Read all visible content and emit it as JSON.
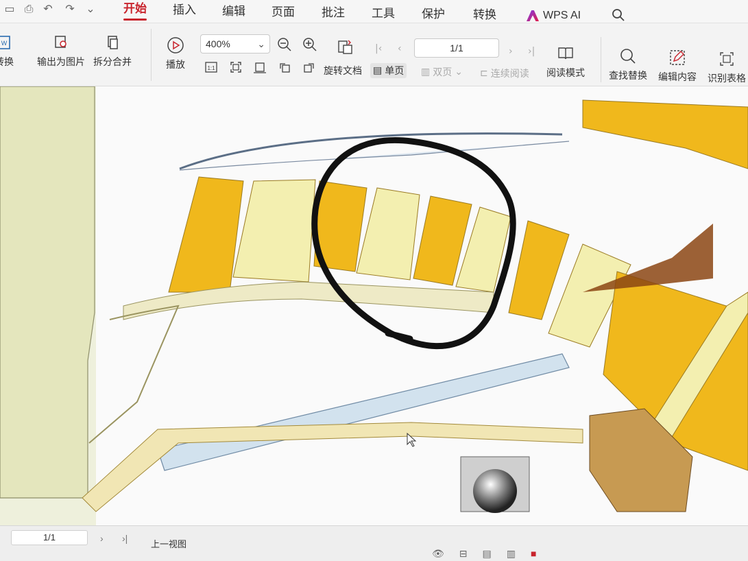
{
  "menubar": {
    "tabs": [
      {
        "label": "开始",
        "active": true
      },
      {
        "label": "插入"
      },
      {
        "label": "编辑"
      },
      {
        "label": "页面"
      },
      {
        "label": "批注"
      },
      {
        "label": "工具"
      },
      {
        "label": "保护"
      },
      {
        "label": "转换"
      }
    ],
    "ai_label": "WPS AI",
    "accent_color": "#c8232c"
  },
  "toolbar": {
    "convert_label": "转换",
    "export_image_label": "输出为图片",
    "split_merge_label": "拆分合并",
    "play_label": "播放",
    "zoom_value": "400%",
    "rotate_doc_label": "旋转文档",
    "page_value": "1/1",
    "single_page_label": "单页",
    "double_page_label": "双页",
    "continuous_label": "连续阅读",
    "reading_mode_label": "阅读模式",
    "find_replace_label": "查找替换",
    "edit_content_label": "编辑内容",
    "recognize_table_label": "识别表格"
  },
  "statusbar": {
    "page_value": "1/1",
    "prev_view_label": "上一视图"
  }
}
